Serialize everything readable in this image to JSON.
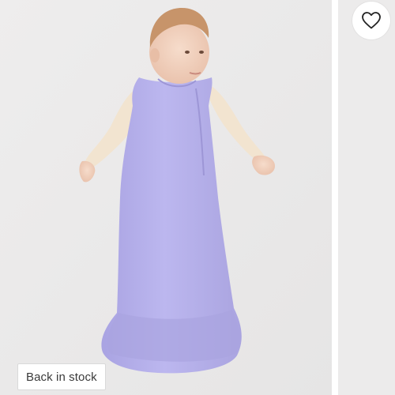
{
  "product": {
    "stock_badge": "Back in stock"
  },
  "icons": {
    "favorite": "heart-outline-icon"
  },
  "colors": {
    "sleep_sack": "#b8b3ea",
    "background": "#ecebeb"
  }
}
